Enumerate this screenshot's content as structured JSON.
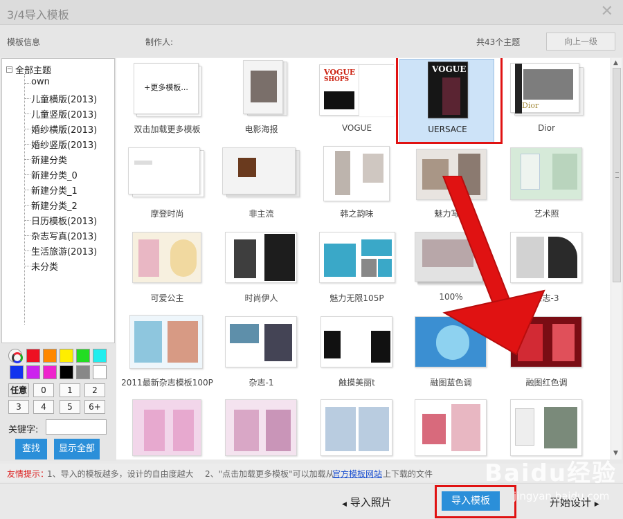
{
  "window": {
    "title": "3/4导入模板",
    "close_icon": "close-icon"
  },
  "info": {
    "template_info": "模板信息",
    "author_label": "制作人:",
    "count": "共43个主题",
    "up_button": "向上一级"
  },
  "tree": {
    "root": "全部主题",
    "items": [
      "own",
      "儿童横版(2013)",
      "儿童竖版(2013)",
      "婚纱横版(2013)",
      "婚纱竖版(2013)",
      "新建分类",
      "新建分类_0",
      "新建分类_1",
      "新建分类_2",
      "日历模板(2013)",
      "杂志写真(2013)",
      "生活旅游(2013)",
      "未分类"
    ]
  },
  "colors": [
    "#ee1122",
    "#ff8800",
    "#ffee00",
    "#22dd22",
    "#22eeee",
    "#1133ee",
    "#cc22ee",
    "#ee22cc",
    "#000000",
    "#888888",
    "#ffffff"
  ],
  "filters": {
    "any": "任意",
    "counts": [
      "0",
      "1",
      "2",
      "3",
      "4",
      "5",
      "6+"
    ]
  },
  "search": {
    "keyword_label": "关键字:",
    "keyword_value": "",
    "find": "查找",
    "show_all": "显示全部"
  },
  "templates": [
    {
      "label": "双击加载更多模板",
      "thumb_text": "+更多模板..."
    },
    {
      "label": "电影海报"
    },
    {
      "label": "VOGUE",
      "thumb_text": "VOGUE",
      "thumb_sub": "SHOPS"
    },
    {
      "label": "UERSACE",
      "thumb_text": "VOGUE"
    },
    {
      "label": "Dior",
      "thumb_text": "Dior"
    },
    {
      "label": "摩登时尚"
    },
    {
      "label": "非主流"
    },
    {
      "label": "韩之韵味"
    },
    {
      "label": "魅力写真"
    },
    {
      "label": "艺术照"
    },
    {
      "label": "可爱公主"
    },
    {
      "label": "时尚伊人"
    },
    {
      "label": "魅力无限105P"
    },
    {
      "label": "100%"
    },
    {
      "label": "杂志-3"
    },
    {
      "label": "2011最新杂志模板100P"
    },
    {
      "label": "杂志-1"
    },
    {
      "label": "触摸美丽t"
    },
    {
      "label": "融图蓝色调"
    },
    {
      "label": "融图红色调"
    },
    {
      "label": ""
    },
    {
      "label": ""
    },
    {
      "label": ""
    },
    {
      "label": ""
    },
    {
      "label": ""
    }
  ],
  "selected_template": "UERSACE",
  "tips": {
    "title": "友情提示：",
    "tip1": "1、导入的模板越多，设计的自由度越大",
    "tip2": "2、\"点击加载更多模板\"可以加载从",
    "link": "官方模板网站",
    "tip3": "上下载的文件"
  },
  "footer": {
    "import_photos": "导入照片",
    "import_template": "导入模板",
    "start_design": "开始设计"
  },
  "watermark": {
    "text": "Baidu经验",
    "sub": "jingyan.baidu.com"
  },
  "accent_color": "#2b8fd9",
  "highlight_color": "#e01212"
}
